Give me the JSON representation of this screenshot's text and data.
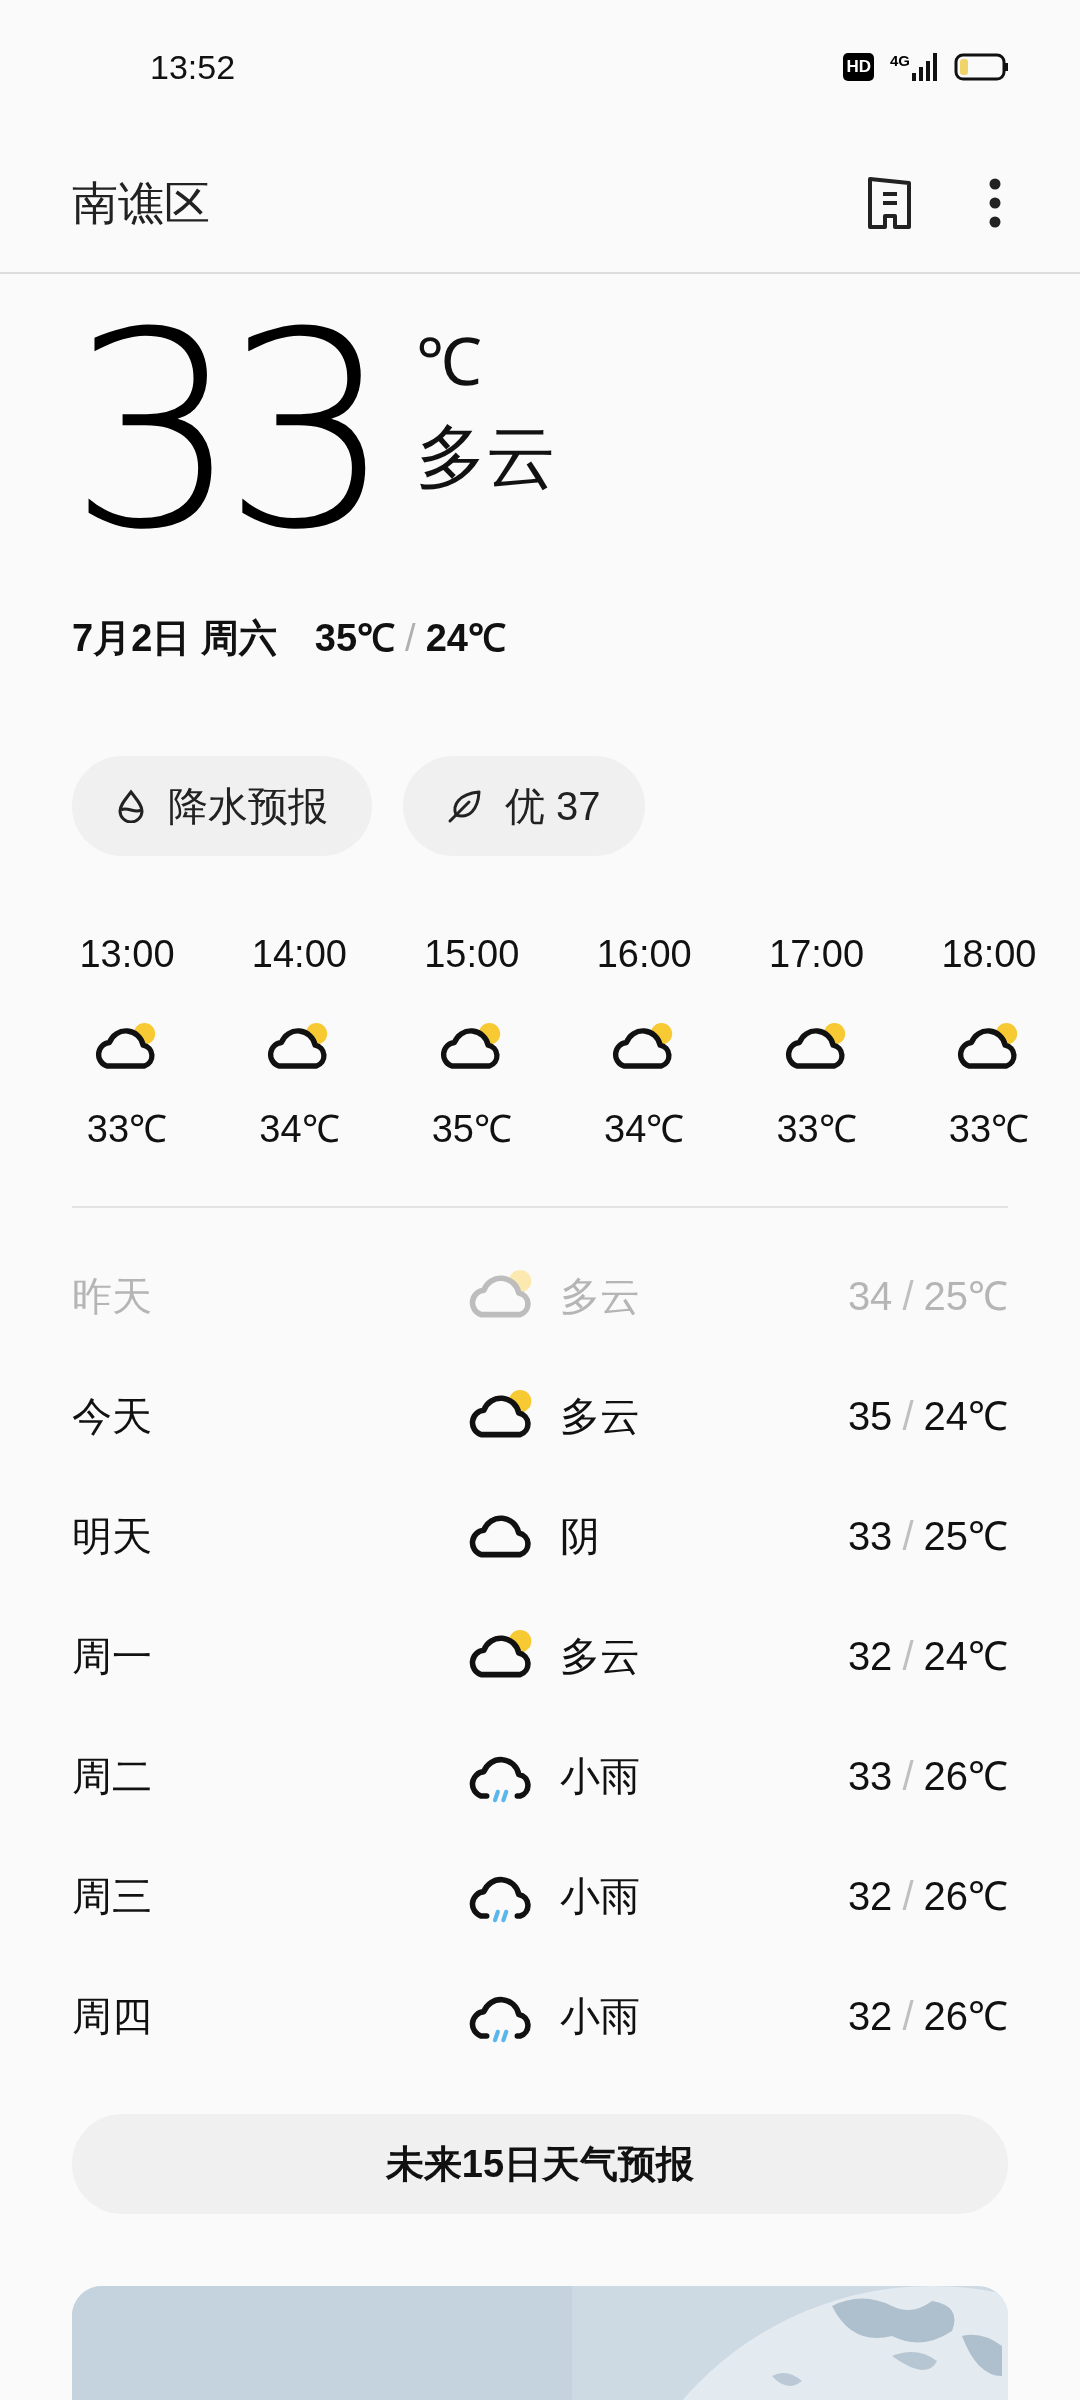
{
  "status_bar": {
    "time": "13:52",
    "hd_badge": "HD",
    "network": "4G"
  },
  "header": {
    "location": "南谯区"
  },
  "current": {
    "temperature": "33",
    "unit": "℃",
    "condition": "多云",
    "date": "7月2日 周六",
    "high": "35℃",
    "sep": "/",
    "low": "24℃"
  },
  "chips": [
    {
      "kind": "rain",
      "label": "降水预报"
    },
    {
      "kind": "air",
      "label": "优 37"
    }
  ],
  "hourly": [
    {
      "time": "13:00",
      "kind": "partly_cloudy",
      "temp": "33℃"
    },
    {
      "time": "14:00",
      "kind": "partly_cloudy",
      "temp": "34℃"
    },
    {
      "time": "15:00",
      "kind": "partly_cloudy",
      "temp": "35℃"
    },
    {
      "time": "16:00",
      "kind": "partly_cloudy",
      "temp": "34℃"
    },
    {
      "time": "17:00",
      "kind": "partly_cloudy",
      "temp": "33℃"
    },
    {
      "time": "18:00",
      "kind": "partly_cloudy",
      "temp": "33℃"
    }
  ],
  "daily": [
    {
      "day": "昨天",
      "past": true,
      "kind": "partly_cloudy",
      "condition": "多云",
      "high": "34",
      "sep": "/",
      "low": "25℃"
    },
    {
      "day": "今天",
      "past": false,
      "kind": "partly_cloudy",
      "condition": "多云",
      "high": "35",
      "sep": "/",
      "low": "24℃"
    },
    {
      "day": "明天",
      "past": false,
      "kind": "cloudy",
      "condition": "阴",
      "high": "33",
      "sep": "/",
      "low": "25℃"
    },
    {
      "day": "周一",
      "past": false,
      "kind": "partly_cloudy",
      "condition": "多云",
      "high": "32",
      "sep": "/",
      "low": "24℃"
    },
    {
      "day": "周二",
      "past": false,
      "kind": "rain",
      "condition": "小雨",
      "high": "33",
      "sep": "/",
      "low": "26℃"
    },
    {
      "day": "周三",
      "past": false,
      "kind": "rain",
      "condition": "小雨",
      "high": "32",
      "sep": "/",
      "low": "26℃"
    },
    {
      "day": "周四",
      "past": false,
      "kind": "rain",
      "condition": "小雨",
      "high": "32",
      "sep": "/",
      "low": "26℃"
    }
  ],
  "forecast_button": "未来15日天气预报"
}
